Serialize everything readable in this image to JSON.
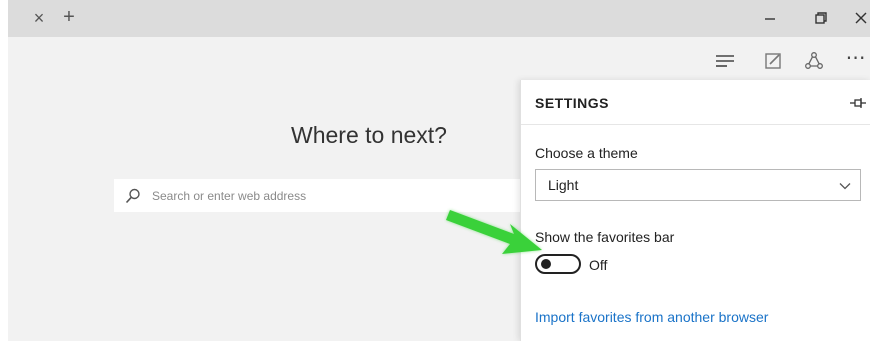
{
  "tabbar": {
    "close_tab_glyph": "×",
    "new_tab_glyph": "+"
  },
  "toolbar": {
    "icons": [
      "hub-icon",
      "web-note-icon",
      "share-icon",
      "more-icon"
    ],
    "more_glyph": "⋯"
  },
  "new_tab_page": {
    "heading": "Where to next?",
    "search_placeholder": "Search or enter web address",
    "search_value": ""
  },
  "settings": {
    "title": "SETTINGS",
    "theme_label": "Choose a theme",
    "theme_value": "Light",
    "favorites_bar_label": "Show the favorites bar",
    "favorites_bar_state": "Off",
    "import_link": "Import favorites from another browser"
  },
  "colors": {
    "link": "#1a73c8",
    "annotation_arrow": "#3ad13a",
    "tabbar_bg": "#dcdcdc",
    "page_bg": "#f2f2f2"
  }
}
